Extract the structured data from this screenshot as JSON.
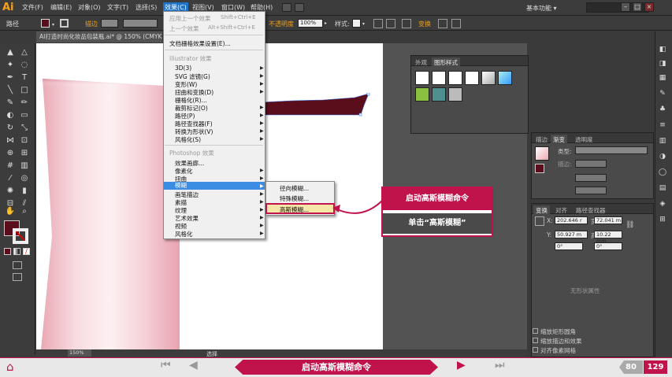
{
  "app": {
    "logo": "Ai",
    "workspace": "基本功能 ▾"
  },
  "menubar": {
    "items": [
      "文件(F)",
      "编辑(E)",
      "对象(O)",
      "文字(T)",
      "选择(S)",
      "效果(C)",
      "视图(V)",
      "窗口(W)",
      "帮助(H)"
    ]
  },
  "controlbar": {
    "path_label": "路径",
    "stroke_label": "描边",
    "opacity_label": "不透明度",
    "opacity_value": "100%",
    "style_label": "样式:",
    "transform_label": "变换"
  },
  "doc_tab": "AI打造时尚化妆品包装瓶.ai* @ 150% (CMYK",
  "effect_menu": {
    "apply_last": "应用上一个效果",
    "apply_last_sc": "Shift+Ctrl+E",
    "last": "上一个效果",
    "last_sc": "Alt+Shift+Ctrl+E",
    "raster_settings": "文档栅格效果设置(E)...",
    "illustrator_header": "Illustrator 效果",
    "illustrator_items": [
      "3D(3)",
      "SVG 滤镜(G)",
      "变形(W)",
      "扭曲和变换(D)",
      "栅格化(R)...",
      "裁剪标记(O)",
      "路径(P)",
      "路径查找器(F)",
      "转换为形状(V)",
      "风格化(S)"
    ],
    "photoshop_header": "Photoshop 效果",
    "photoshop_items": [
      "效果画廊...",
      "像素化",
      "扭曲",
      "模糊",
      "画笔描边",
      "素描",
      "纹理",
      "艺术效果",
      "视频",
      "风格化"
    ]
  },
  "blur_submenu": {
    "items": [
      "径向模糊...",
      "特殊模糊...",
      "高斯模糊..."
    ]
  },
  "callout": {
    "title": "启动高斯模糊命令",
    "body": "单击“高斯模糊”"
  },
  "appearance_panel": {
    "tabs": [
      "外观",
      "图形样式"
    ]
  },
  "gradient_panel": {
    "tabs": [
      "描边",
      "渐变",
      "透明度"
    ],
    "type_label": "类型:",
    "stroke_label": "描边:"
  },
  "transform_panel": {
    "tabs": [
      "变换",
      "对齐",
      "路径查找器"
    ],
    "x_label": "X:",
    "x": "202.646 r",
    "w_label": "宽:",
    "w": "72.041 m",
    "y_label": "Y:",
    "y": "50.927 m",
    "h_label": "高:",
    "h": "10.22 mm",
    "angle1": "0°",
    "angle2": "0°",
    "no_shape": "无形状属性",
    "options": [
      "缩放矩形圆角",
      "缩放描边和效果",
      "对齐像素网格"
    ]
  },
  "statusbar": {
    "zoom": "150%",
    "label": "选择"
  },
  "bottom_nav": {
    "title": "启动高斯模糊命令",
    "current_page": "80",
    "total_pages": "129"
  },
  "colors": {
    "accent": "#c0134b",
    "menu_highlight": "#3b8de3",
    "fill_swatch": "#5a0e1c"
  }
}
